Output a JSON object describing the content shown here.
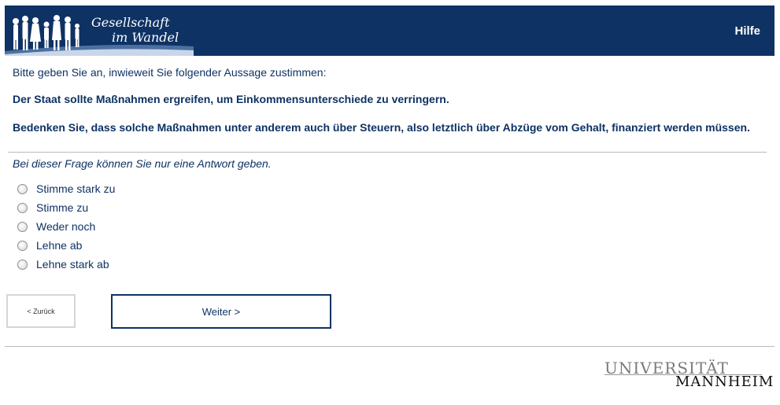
{
  "header": {
    "logo_line1": "Gesellschaft",
    "logo_line2": "im Wandel",
    "help_label": "Hilfe"
  },
  "question": {
    "intro": "Bitte geben Sie an, inwieweit Sie folgender Aussage zustimmen:",
    "statement": "Der Staat sollte Maßnahmen ergreifen, um Einkommensunterschiede zu verringern.",
    "note": "Bedenken Sie, dass solche Maßnahmen unter anderem auch über Steuern, also letztlich über Abzüge vom Gehalt, finanziert werden müssen.",
    "instruction": "Bei dieser Frage können Sie nur eine Antwort geben.",
    "options": [
      {
        "label": "Stimme stark zu"
      },
      {
        "label": "Stimme zu"
      },
      {
        "label": "Weder noch"
      },
      {
        "label": "Lehne ab"
      },
      {
        "label": "Lehne stark ab"
      }
    ]
  },
  "navigation": {
    "back_label": "< Zurück",
    "next_label": "Weiter >"
  },
  "footer": {
    "university_line1": "UNIVERSITÄT",
    "university_line2": "MANNHEIM"
  },
  "colors": {
    "brand_blue": "#0e3264"
  },
  "icons": {
    "logo": "people-silhouette-icon",
    "radio": "radio-button-icon"
  }
}
